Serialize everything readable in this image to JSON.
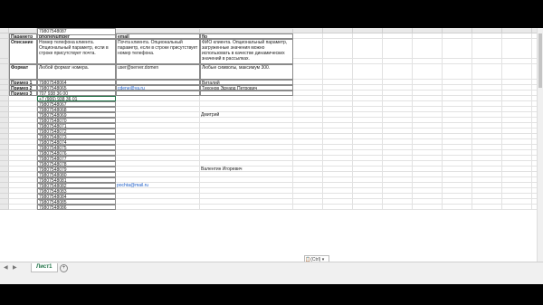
{
  "columns": [
    "A",
    "B",
    "C",
    "D",
    "E",
    "F",
    "G",
    "H",
    "I",
    "J",
    "K",
    "L",
    "M",
    "N"
  ],
  "rows": [
    "1",
    "2",
    "3",
    "4",
    "5",
    "6",
    "7",
    "8",
    "9",
    "10",
    "11",
    "12",
    "13",
    "14",
    "15",
    "16",
    "17",
    "18",
    "19",
    "20",
    "21",
    "22",
    "23",
    "24",
    "25",
    "26",
    "27",
    "28"
  ],
  "header_row": {
    "a": "Параметр",
    "b": "phoneNumber",
    "c": "email",
    "d": "fio"
  },
  "description_row": {
    "a": "Описание",
    "b": "Номер телефона клиента. Опциональный параметр, если в строке присутствует почта.",
    "c": "Почта клиента. Опциональный параметр, если в строке присутствует номер телефона.",
    "d": "ФИО клиента. Опциональный параметр, загруженные значения можно использовать в качестве динамических значений в рассылках."
  },
  "format_row": {
    "a": "Формат",
    "b": "Любой формат номера.",
    "c": "user@server.domen",
    "d": "Любые символы, максимум 300."
  },
  "examples": [
    {
      "a": "Пример 1",
      "b": "79807548064",
      "c": "",
      "d": "Виталий"
    },
    {
      "a": "Пример 2",
      "b": "79807548065",
      "c": "cdene@ya.ru",
      "d": "Тихонов Эдуард Петрович"
    },
    {
      "a": "Пример 3",
      "b": "707 938 36 00",
      "c": "",
      "d": ""
    }
  ],
  "data_rows": [
    {
      "b": "+7 (906) 938 36 01",
      "c": "",
      "d": ""
    },
    {
      "b": "79807548067",
      "c": "",
      "d": ""
    },
    {
      "b": "79807548068",
      "c": "",
      "d": ""
    },
    {
      "b": "79807548069",
      "c": "",
      "d": "Дмитрий"
    },
    {
      "b": "79807548070",
      "c": "",
      "d": ""
    },
    {
      "b": "79807548071",
      "c": "",
      "d": ""
    },
    {
      "b": "79807548072",
      "c": "",
      "d": ""
    },
    {
      "b": "79807548073",
      "c": "",
      "d": ""
    },
    {
      "b": "79807548074",
      "c": "",
      "d": ""
    },
    {
      "b": "79807548075",
      "c": "",
      "d": ""
    },
    {
      "b": "79807548076",
      "c": "",
      "d": ""
    },
    {
      "b": "79807548077",
      "c": "",
      "d": ""
    },
    {
      "b": "79807548078",
      "c": "",
      "d": ""
    },
    {
      "b": "79807548079",
      "c": "",
      "d": "Валентин Игоревич"
    },
    {
      "b": "79807548080",
      "c": "",
      "d": ""
    },
    {
      "b": "79807548081",
      "c": "",
      "d": ""
    },
    {
      "b": "79807548082",
      "c": "pochta@mail.ru",
      "d": ""
    },
    {
      "b": "79807548083",
      "c": "",
      "d": ""
    },
    {
      "b": "79807548084",
      "c": "",
      "d": ""
    },
    {
      "b": "79807548085",
      "c": "",
      "d": ""
    },
    {
      "b": "79807548086",
      "c": "",
      "d": ""
    },
    {
      "b": "79807548087",
      "c": "",
      "d": ""
    }
  ],
  "sheet_tab": "Лист1",
  "add_sheet_icon": "plus-icon",
  "paste_options_label": "(Ctrl) ▾"
}
